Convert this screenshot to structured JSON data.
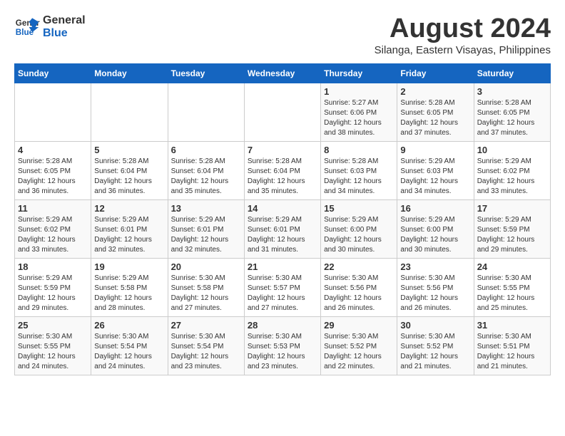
{
  "logo": {
    "line1": "General",
    "line2": "Blue"
  },
  "title": "August 2024",
  "subtitle": "Silanga, Eastern Visayas, Philippines",
  "header": {
    "days": [
      "Sunday",
      "Monday",
      "Tuesday",
      "Wednesday",
      "Thursday",
      "Friday",
      "Saturday"
    ]
  },
  "weeks": [
    [
      {
        "day": "",
        "info": ""
      },
      {
        "day": "",
        "info": ""
      },
      {
        "day": "",
        "info": ""
      },
      {
        "day": "",
        "info": ""
      },
      {
        "day": "1",
        "info": "Sunrise: 5:27 AM\nSunset: 6:06 PM\nDaylight: 12 hours\nand 38 minutes."
      },
      {
        "day": "2",
        "info": "Sunrise: 5:28 AM\nSunset: 6:05 PM\nDaylight: 12 hours\nand 37 minutes."
      },
      {
        "day": "3",
        "info": "Sunrise: 5:28 AM\nSunset: 6:05 PM\nDaylight: 12 hours\nand 37 minutes."
      }
    ],
    [
      {
        "day": "4",
        "info": "Sunrise: 5:28 AM\nSunset: 6:05 PM\nDaylight: 12 hours\nand 36 minutes."
      },
      {
        "day": "5",
        "info": "Sunrise: 5:28 AM\nSunset: 6:04 PM\nDaylight: 12 hours\nand 36 minutes."
      },
      {
        "day": "6",
        "info": "Sunrise: 5:28 AM\nSunset: 6:04 PM\nDaylight: 12 hours\nand 35 minutes."
      },
      {
        "day": "7",
        "info": "Sunrise: 5:28 AM\nSunset: 6:04 PM\nDaylight: 12 hours\nand 35 minutes."
      },
      {
        "day": "8",
        "info": "Sunrise: 5:28 AM\nSunset: 6:03 PM\nDaylight: 12 hours\nand 34 minutes."
      },
      {
        "day": "9",
        "info": "Sunrise: 5:29 AM\nSunset: 6:03 PM\nDaylight: 12 hours\nand 34 minutes."
      },
      {
        "day": "10",
        "info": "Sunrise: 5:29 AM\nSunset: 6:02 PM\nDaylight: 12 hours\nand 33 minutes."
      }
    ],
    [
      {
        "day": "11",
        "info": "Sunrise: 5:29 AM\nSunset: 6:02 PM\nDaylight: 12 hours\nand 33 minutes."
      },
      {
        "day": "12",
        "info": "Sunrise: 5:29 AM\nSunset: 6:01 PM\nDaylight: 12 hours\nand 32 minutes."
      },
      {
        "day": "13",
        "info": "Sunrise: 5:29 AM\nSunset: 6:01 PM\nDaylight: 12 hours\nand 32 minutes."
      },
      {
        "day": "14",
        "info": "Sunrise: 5:29 AM\nSunset: 6:01 PM\nDaylight: 12 hours\nand 31 minutes."
      },
      {
        "day": "15",
        "info": "Sunrise: 5:29 AM\nSunset: 6:00 PM\nDaylight: 12 hours\nand 30 minutes."
      },
      {
        "day": "16",
        "info": "Sunrise: 5:29 AM\nSunset: 6:00 PM\nDaylight: 12 hours\nand 30 minutes."
      },
      {
        "day": "17",
        "info": "Sunrise: 5:29 AM\nSunset: 5:59 PM\nDaylight: 12 hours\nand 29 minutes."
      }
    ],
    [
      {
        "day": "18",
        "info": "Sunrise: 5:29 AM\nSunset: 5:59 PM\nDaylight: 12 hours\nand 29 minutes."
      },
      {
        "day": "19",
        "info": "Sunrise: 5:29 AM\nSunset: 5:58 PM\nDaylight: 12 hours\nand 28 minutes."
      },
      {
        "day": "20",
        "info": "Sunrise: 5:30 AM\nSunset: 5:58 PM\nDaylight: 12 hours\nand 27 minutes."
      },
      {
        "day": "21",
        "info": "Sunrise: 5:30 AM\nSunset: 5:57 PM\nDaylight: 12 hours\nand 27 minutes."
      },
      {
        "day": "22",
        "info": "Sunrise: 5:30 AM\nSunset: 5:56 PM\nDaylight: 12 hours\nand 26 minutes."
      },
      {
        "day": "23",
        "info": "Sunrise: 5:30 AM\nSunset: 5:56 PM\nDaylight: 12 hours\nand 26 minutes."
      },
      {
        "day": "24",
        "info": "Sunrise: 5:30 AM\nSunset: 5:55 PM\nDaylight: 12 hours\nand 25 minutes."
      }
    ],
    [
      {
        "day": "25",
        "info": "Sunrise: 5:30 AM\nSunset: 5:55 PM\nDaylight: 12 hours\nand 24 minutes."
      },
      {
        "day": "26",
        "info": "Sunrise: 5:30 AM\nSunset: 5:54 PM\nDaylight: 12 hours\nand 24 minutes."
      },
      {
        "day": "27",
        "info": "Sunrise: 5:30 AM\nSunset: 5:54 PM\nDaylight: 12 hours\nand 23 minutes."
      },
      {
        "day": "28",
        "info": "Sunrise: 5:30 AM\nSunset: 5:53 PM\nDaylight: 12 hours\nand 23 minutes."
      },
      {
        "day": "29",
        "info": "Sunrise: 5:30 AM\nSunset: 5:52 PM\nDaylight: 12 hours\nand 22 minutes."
      },
      {
        "day": "30",
        "info": "Sunrise: 5:30 AM\nSunset: 5:52 PM\nDaylight: 12 hours\nand 21 minutes."
      },
      {
        "day": "31",
        "info": "Sunrise: 5:30 AM\nSunset: 5:51 PM\nDaylight: 12 hours\nand 21 minutes."
      }
    ]
  ]
}
